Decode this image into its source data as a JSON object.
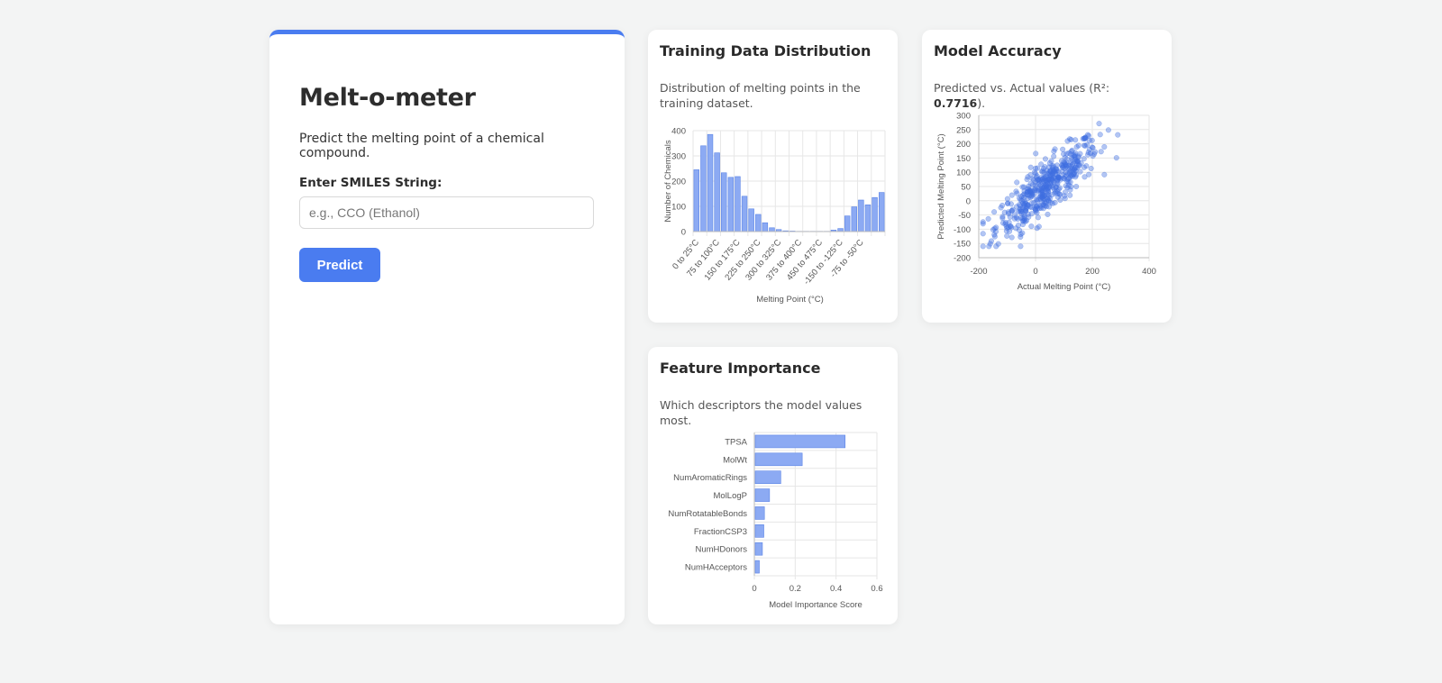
{
  "app": {
    "title": "Melt-o-meter",
    "description": "Predict the melting point of a chemical compound.",
    "input_label": "Enter SMILES String:",
    "input_placeholder": "e.g., CCO (Ethanol)",
    "input_value": "",
    "predict_label": "Predict"
  },
  "colors": {
    "accent": "#4a7cf0",
    "bar_fill": "#8caaf3",
    "bar_stroke": "#5b84e6",
    "point": "#3f6fe0"
  },
  "cards": {
    "histogram": {
      "title": "Training Data Distribution",
      "subtitle": "Distribution of melting points in the training dataset."
    },
    "accuracy": {
      "title": "Model Accuracy",
      "subtitle_prefix": "Predicted vs. Actual values (R²: ",
      "r2": "0.7716",
      "subtitle_suffix": ")."
    },
    "features": {
      "title": "Feature Importance",
      "subtitle": "Which descriptors the model values most."
    }
  },
  "chart_data": [
    {
      "type": "bar",
      "xlabel": "Melting Point (°C)",
      "ylabel": "Number of Chemicals",
      "ylim": [
        0,
        400
      ],
      "yticks": [
        0,
        100,
        200,
        300,
        400
      ],
      "tick_labels": [
        "0 to 25°C",
        "75 to 100°C",
        "150 to 175°C",
        "225 to 250°C",
        "300 to 325°C",
        "375 to 400°C",
        "450 to 475°C",
        "-150 to -125°C",
        "-75 to -50°C"
      ],
      "values": [
        245,
        340,
        385,
        312,
        233,
        215,
        218,
        140,
        90,
        68,
        35,
        15,
        8,
        3,
        2,
        1,
        1,
        1,
        1,
        1,
        6,
        12,
        62,
        98,
        125,
        106,
        135,
        155
      ],
      "grid": true
    },
    {
      "type": "scatter",
      "xlabel": "Actual Melting Point (°C)",
      "ylabel": "Predicted Melting Point (°C)",
      "xlim": [
        -200,
        400
      ],
      "ylim": [
        -200,
        300
      ],
      "xticks": [
        -200,
        0,
        200,
        400
      ],
      "yticks": [
        -200,
        -150,
        -100,
        -50,
        0,
        50,
        100,
        150,
        200,
        250,
        300
      ],
      "r2": 0.7716,
      "grid": true,
      "n_points": 480
    },
    {
      "type": "bar",
      "orientation": "horizontal",
      "xlabel": "Model Importance Score",
      "xlim": [
        0,
        0.6
      ],
      "xticks": [
        0,
        0.2,
        0.4,
        0.6
      ],
      "categories": [
        "TPSA",
        "MolWt",
        "NumAromaticRings",
        "MolLogP",
        "NumRotatableBonds",
        "FractionCSP3",
        "NumHDonors",
        "NumHAcceptors"
      ],
      "values": [
        0.44,
        0.23,
        0.125,
        0.07,
        0.045,
        0.042,
        0.035,
        0.02
      ],
      "grid": true
    }
  ]
}
